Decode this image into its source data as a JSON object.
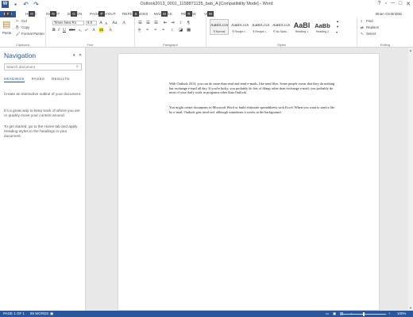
{
  "window": {
    "title": "Outlook2013_0001_1158871135_bab_A [Compatibility Mode] - Word",
    "controls": [
      "?",
      "▫",
      "─",
      "□",
      "✕"
    ]
  },
  "qat": {
    "icons": [
      "word-icon",
      "save-icon",
      "undo-icon",
      "redo-icon"
    ]
  },
  "tabs": [
    "FILE",
    "HOME",
    "INSERT",
    "DESIGN",
    "PAGE LAYOUT",
    "REFERENCES",
    "MAILINGS",
    "REVIEW",
    "VIEW"
  ],
  "keytips": [
    "F",
    "H",
    "N",
    "G",
    "P",
    "S",
    "M",
    "R",
    "W"
  ],
  "user": "Brian Grobridski",
  "ribbon": {
    "clipboard": {
      "paste": "Paste",
      "cut": "Cut",
      "copy": "Copy",
      "format_painter": "Format Painter",
      "label": "Clipboard"
    },
    "font": {
      "font_name": "Times New Ro",
      "font_size": "9.5",
      "label": "Font"
    },
    "paragraph": {
      "label": "Paragraph"
    },
    "styles": {
      "label": "Styles",
      "items": [
        {
          "sample": "AaBbCcDc",
          "name": "¶ Normal"
        },
        {
          "sample": "AaBbCcDc",
          "name": "¶ Recipe I..."
        },
        {
          "sample": "AaBbCcDc",
          "name": "¶ Recipe I..."
        },
        {
          "sample": "AaBbCcDc",
          "name": "¶ No Spac..."
        },
        {
          "sample": "AaBl",
          "name": "Heading 1"
        },
        {
          "sample": "AaBb",
          "name": "Heading 2"
        }
      ]
    },
    "editing": {
      "find": "Find",
      "replace": "Replace",
      "select": "Select",
      "label": "Editing"
    }
  },
  "navigation": {
    "title": "Navigation",
    "search_placeholder": "Search document",
    "tabs": [
      "HEADINGS",
      "PAGES",
      "RESULTS"
    ],
    "paragraphs": [
      "Create an interactive outline of your document.",
      "It's a great way to keep track of where you are or quickly move your content around.",
      "To get started, go to the Home tab and apply Heading styles to the headings in your document."
    ]
  },
  "document": {
    "paragraphs": [
      "With Outlook 2013, you can do more than read and send e-mails, like send files. Some people swear that they do nothing but exchange e-mail all day. If you're lucky, you probably do lots of things other than exchange e-mail; you probably do most of your daily work in programs other than Outlook.",
      "You might create documents in Microsoft Word or build elaborate spreadsheets with Excel. When you want to send a file by e-mail, Outlook gets involved, although sometimes it works in the background."
    ]
  },
  "status": {
    "page": "PAGE 1 OF 1",
    "words": "89 WORDS",
    "zoom": "100%",
    "zoom_level": 0.5
  },
  "colors": {
    "accent": "#2b579a"
  }
}
